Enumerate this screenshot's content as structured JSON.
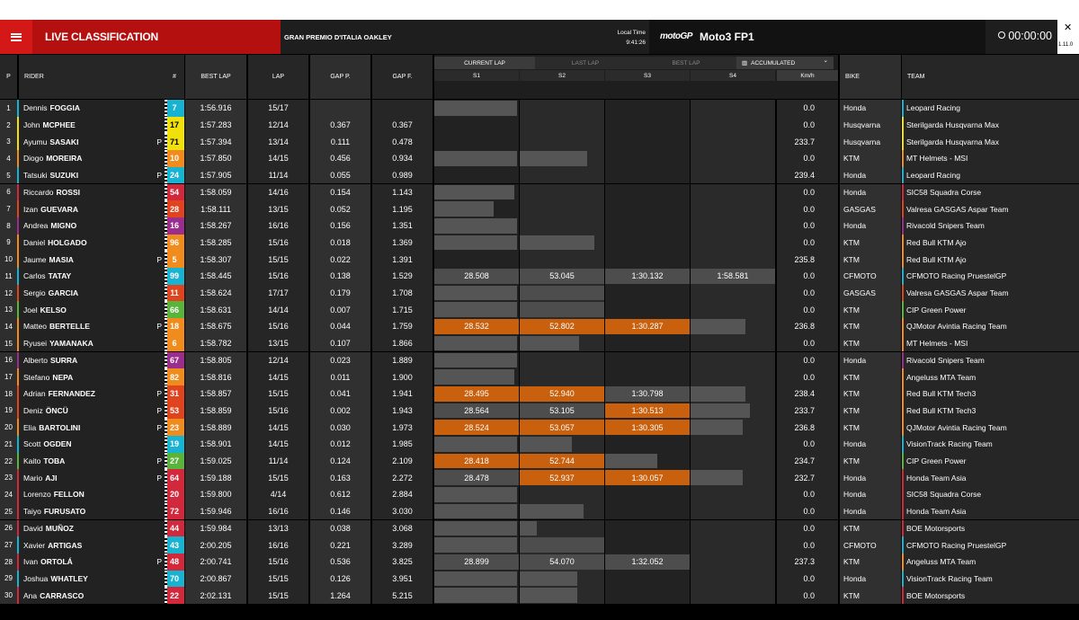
{
  "header": {
    "title": "LIVE CLASSIFICATION",
    "event": "GRAN PREMIO D'ITALIA OAKLEY",
    "local_time_label": "Local Time",
    "local_time": "9:41:26",
    "brand": "motoGP",
    "session": "Moto3 FP1",
    "timer": "00:00:00",
    "version": "1.11.0"
  },
  "columns": {
    "pos": "P",
    "rider": "RIDER",
    "num": "#",
    "best_lap": "BEST LAP",
    "lap": "LAP",
    "gap_p": "GAP P.",
    "gap_f": "GAP F.",
    "s1": "S1",
    "s2": "S2",
    "s3": "S3",
    "s4": "S4",
    "kmh": "Km/h",
    "bike": "BIKE",
    "team": "TEAM"
  },
  "lap_modes": [
    "CURRENT LAP",
    "LAST LAP",
    "BEST LAP"
  ],
  "selected_mode": "ACCUMULATED",
  "colors": {
    "orange": "#c8600e",
    "red": "#d41717"
  },
  "rows": [
    {
      "pos": "1",
      "first": "Dennis",
      "last": "FOGGIA",
      "p": "",
      "num": "7",
      "numcolor": "#19b3d2",
      "best": "1:56.916",
      "lap": "15/17",
      "gapp": "",
      "gapf": "",
      "b1": 0.98,
      "b2": 0,
      "b3": 0,
      "b4": 0,
      "s1": "",
      "s2": "",
      "s3": "",
      "s4": "",
      "o1": false,
      "o2": false,
      "o3": false,
      "kmh": "0.0",
      "bike": "Honda",
      "team": "Leopard Racing",
      "teamcolor": "#19b3d2"
    },
    {
      "pos": "2",
      "first": "John",
      "last": "MCPHEE",
      "p": "",
      "num": "17",
      "numcolor": "#f0e10a",
      "best": "1:57.283",
      "lap": "12/14",
      "gapp": "0.367",
      "gapf": "0.367",
      "b1": 0,
      "b2": 0,
      "b3": 0,
      "b4": 0,
      "s1": "",
      "s2": "",
      "s3": "",
      "s4": "",
      "o1": false,
      "o2": false,
      "o3": false,
      "kmh": "0.0",
      "bike": "Husqvarna",
      "team": "Sterilgarda Husqvarna Max",
      "teamcolor": "#f0e10a"
    },
    {
      "pos": "3",
      "first": "Ayumu",
      "last": "SASAKI",
      "p": "P",
      "num": "71",
      "numcolor": "#f0e10a",
      "best": "1:57.394",
      "lap": "13/14",
      "gapp": "0.111",
      "gapf": "0.478",
      "b1": 0,
      "b2": 0,
      "b3": 0,
      "b4": 0,
      "s1": "",
      "s2": "",
      "s3": "",
      "s4": "",
      "o1": false,
      "o2": false,
      "o3": false,
      "kmh": "233.7",
      "bike": "Husqvarna",
      "team": "Sterilgarda Husqvarna Max",
      "teamcolor": "#f0e10a"
    },
    {
      "pos": "4",
      "first": "Diogo",
      "last": "MOREIRA",
      "p": "",
      "num": "10",
      "numcolor": "#f08c1e",
      "best": "1:57.850",
      "lap": "14/15",
      "gapp": "0.456",
      "gapf": "0.934",
      "b1": 0.98,
      "b2": 0.8,
      "b3": 0,
      "b4": 0,
      "s1": "",
      "s2": "",
      "s3": "",
      "s4": "",
      "o1": false,
      "o2": false,
      "o3": false,
      "kmh": "0.0",
      "bike": "KTM",
      "team": "MT Helmets - MSI",
      "teamcolor": "#f08c1e"
    },
    {
      "pos": "5",
      "first": "Tatsuki",
      "last": "SUZUKI",
      "p": "P",
      "num": "24",
      "numcolor": "#19b3d2",
      "best": "1:57.905",
      "lap": "11/14",
      "gapp": "0.055",
      "gapf": "0.989",
      "b1": 0,
      "b2": 0,
      "b3": 0,
      "b4": 0,
      "s1": "",
      "s2": "",
      "s3": "",
      "s4": "",
      "o1": false,
      "o2": false,
      "o3": false,
      "kmh": "239.4",
      "bike": "Honda",
      "team": "Leopard Racing",
      "teamcolor": "#19b3d2"
    },
    {
      "pos": "6",
      "first": "Riccardo",
      "last": "ROSSI",
      "p": "",
      "num": "54",
      "numcolor": "#d2283c",
      "best": "1:58.059",
      "lap": "14/16",
      "gapp": "0.154",
      "gapf": "1.143",
      "b1": 0.95,
      "b2": 0,
      "b3": 0,
      "b4": 0,
      "s1": "",
      "s2": "",
      "s3": "",
      "s4": "",
      "o1": false,
      "o2": false,
      "o3": false,
      "kmh": "0.0",
      "bike": "Honda",
      "team": "SIC58 Squadra Corse",
      "teamcolor": "#d2283c"
    },
    {
      "pos": "7",
      "first": "Izan",
      "last": "GUEVARA",
      "p": "",
      "num": "28",
      "numcolor": "#e0441e",
      "best": "1:58.111",
      "lap": "13/15",
      "gapp": "0.052",
      "gapf": "1.195",
      "b1": 0.7,
      "b2": 0,
      "b3": 0,
      "b4": 0,
      "s1": "",
      "s2": "",
      "s3": "",
      "s4": "",
      "o1": false,
      "o2": false,
      "o3": false,
      "kmh": "0.0",
      "bike": "GASGAS",
      "team": "Valresa GASGAS Aspar Team",
      "teamcolor": "#e0441e"
    },
    {
      "pos": "8",
      "first": "Andrea",
      "last": "MIGNO",
      "p": "",
      "num": "16",
      "numcolor": "#9b2e8c",
      "best": "1:58.267",
      "lap": "16/16",
      "gapp": "0.156",
      "gapf": "1.351",
      "b1": 0.98,
      "b2": 0,
      "b3": 0,
      "b4": 0,
      "s1": "",
      "s2": "",
      "s3": "",
      "s4": "",
      "o1": false,
      "o2": false,
      "o3": false,
      "kmh": "0.0",
      "bike": "Honda",
      "team": "Rivacold Snipers Team",
      "teamcolor": "#9b2e8c"
    },
    {
      "pos": "9",
      "first": "Daniel",
      "last": "HOLGADO",
      "p": "",
      "num": "96",
      "numcolor": "#f08c1e",
      "best": "1:58.285",
      "lap": "15/16",
      "gapp": "0.018",
      "gapf": "1.369",
      "b1": 0.98,
      "b2": 0.88,
      "b3": 0,
      "b4": 0,
      "s1": "",
      "s2": "",
      "s3": "",
      "s4": "",
      "o1": false,
      "o2": false,
      "o3": false,
      "kmh": "0.0",
      "bike": "KTM",
      "team": "Red Bull KTM Ajo",
      "teamcolor": "#f08c1e"
    },
    {
      "pos": "10",
      "first": "Jaume",
      "last": "MASIA",
      "p": "P",
      "num": "5",
      "numcolor": "#f08c1e",
      "best": "1:58.307",
      "lap": "15/15",
      "gapp": "0.022",
      "gapf": "1.391",
      "b1": 0,
      "b2": 0,
      "b3": 0,
      "b4": 0,
      "s1": "",
      "s2": "",
      "s3": "",
      "s4": "",
      "o1": false,
      "o2": false,
      "o3": false,
      "kmh": "235.8",
      "bike": "KTM",
      "team": "Red Bull KTM Ajo",
      "teamcolor": "#f08c1e"
    },
    {
      "pos": "11",
      "first": "Carlos",
      "last": "TATAY",
      "p": "",
      "num": "99",
      "numcolor": "#19b3d2",
      "best": "1:58.445",
      "lap": "15/16",
      "gapp": "0.138",
      "gapf": "1.529",
      "b1": 1,
      "b2": 1,
      "b3": 1,
      "b4": 1,
      "s1": "28.508",
      "s2": "53.045",
      "s3": "1:30.132",
      "s4": "1:58.581",
      "o1": false,
      "o2": false,
      "o3": false,
      "kmh": "0.0",
      "bike": "CFMOTO",
      "team": "CFMOTO Racing PruestelGP",
      "teamcolor": "#19b3d2"
    },
    {
      "pos": "12",
      "first": "Sergio",
      "last": "GARCIA",
      "p": "",
      "num": "11",
      "numcolor": "#e0441e",
      "best": "1:58.624",
      "lap": "17/17",
      "gapp": "0.179",
      "gapf": "1.708",
      "b1": 0.98,
      "b2": 1,
      "b3": 0,
      "b4": 0,
      "s1": "",
      "s2": "",
      "s3": "",
      "s4": "",
      "o1": false,
      "o2": false,
      "o3": false,
      "kmh": "0.0",
      "bike": "GASGAS",
      "team": "Valresa GASGAS Aspar Team",
      "teamcolor": "#e0441e"
    },
    {
      "pos": "13",
      "first": "Joel",
      "last": "KELSO",
      "p": "",
      "num": "66",
      "numcolor": "#5ab43c",
      "best": "1:58.631",
      "lap": "14/14",
      "gapp": "0.007",
      "gapf": "1.715",
      "b1": 0.98,
      "b2": 1,
      "b3": 0,
      "b4": 0,
      "s1": "",
      "s2": "",
      "s3": "",
      "s4": "",
      "o1": false,
      "o2": false,
      "o3": false,
      "kmh": "0.0",
      "bike": "KTM",
      "team": "CIP Green Power",
      "teamcolor": "#5ab43c"
    },
    {
      "pos": "14",
      "first": "Matteo",
      "last": "BERTELLE",
      "p": "P",
      "num": "18",
      "numcolor": "#f08c1e",
      "best": "1:58.675",
      "lap": "15/16",
      "gapp": "0.044",
      "gapf": "1.759",
      "b1": 1,
      "b2": 1,
      "b3": 1,
      "b4": 0.65,
      "s1": "28.532",
      "s2": "52.802",
      "s3": "1:30.287",
      "s4": "",
      "o1": true,
      "o2": true,
      "o3": true,
      "kmh": "236.8",
      "bike": "KTM",
      "team": "QJMotor Avintia Racing Team",
      "teamcolor": "#f08c1e"
    },
    {
      "pos": "15",
      "first": "Ryusei",
      "last": "YAMANAKA",
      "p": "",
      "num": "6",
      "numcolor": "#f08c1e",
      "best": "1:58.782",
      "lap": "13/15",
      "gapp": "0.107",
      "gapf": "1.866",
      "b1": 0.98,
      "b2": 0.7,
      "b3": 0,
      "b4": 0,
      "s1": "",
      "s2": "",
      "s3": "",
      "s4": "",
      "o1": false,
      "o2": false,
      "o3": false,
      "kmh": "0.0",
      "bike": "KTM",
      "team": "MT Helmets - MSI",
      "teamcolor": "#f08c1e"
    },
    {
      "pos": "16",
      "first": "Alberto",
      "last": "SURRA",
      "p": "",
      "num": "67",
      "numcolor": "#9b2e8c",
      "best": "1:58.805",
      "lap": "12/14",
      "gapp": "0.023",
      "gapf": "1.889",
      "b1": 0.98,
      "b2": 0,
      "b3": 0,
      "b4": 0,
      "s1": "",
      "s2": "",
      "s3": "",
      "s4": "",
      "o1": false,
      "o2": false,
      "o3": false,
      "kmh": "0.0",
      "bike": "Honda",
      "team": "Rivacold Snipers Team",
      "teamcolor": "#9b2e8c"
    },
    {
      "pos": "17",
      "first": "Stefano",
      "last": "NEPA",
      "p": "",
      "num": "82",
      "numcolor": "#f08c1e",
      "best": "1:58.816",
      "lap": "14/15",
      "gapp": "0.011",
      "gapf": "1.900",
      "b1": 0.95,
      "b2": 0,
      "b3": 0,
      "b4": 0,
      "s1": "",
      "s2": "",
      "s3": "",
      "s4": "",
      "o1": false,
      "o2": false,
      "o3": false,
      "kmh": "0.0",
      "bike": "KTM",
      "team": "Angeluss MTA Team",
      "teamcolor": "#f08c1e"
    },
    {
      "pos": "18",
      "first": "Adrian",
      "last": "FERNANDEZ",
      "p": "P",
      "num": "31",
      "numcolor": "#e0441e",
      "best": "1:58.857",
      "lap": "15/15",
      "gapp": "0.041",
      "gapf": "1.941",
      "b1": 1,
      "b2": 1,
      "b3": 1,
      "b4": 0.65,
      "s1": "28.495",
      "s2": "52.940",
      "s3": "1:30.798",
      "s4": "",
      "o1": true,
      "o2": true,
      "o3": false,
      "kmh": "238.4",
      "bike": "KTM",
      "team": "Red Bull KTM Tech3",
      "teamcolor": "#f08c1e"
    },
    {
      "pos": "19",
      "first": "Deniz",
      "last": "ÖNCÜ",
      "p": "P",
      "num": "53",
      "numcolor": "#e0441e",
      "best": "1:58.859",
      "lap": "15/16",
      "gapp": "0.002",
      "gapf": "1.943",
      "b1": 1,
      "b2": 1,
      "b3": 1,
      "b4": 0.7,
      "s1": "28.564",
      "s2": "53.105",
      "s3": "1:30.513",
      "s4": "",
      "o1": false,
      "o2": false,
      "o3": true,
      "kmh": "233.7",
      "bike": "KTM",
      "team": "Red Bull KTM Tech3",
      "teamcolor": "#f08c1e"
    },
    {
      "pos": "20",
      "first": "Elia",
      "last": "BARTOLINI",
      "p": "P",
      "num": "23",
      "numcolor": "#f08c1e",
      "best": "1:58.889",
      "lap": "14/15",
      "gapp": "0.030",
      "gapf": "1.973",
      "b1": 1,
      "b2": 1,
      "b3": 1,
      "b4": 0.62,
      "s1": "28.524",
      "s2": "53.057",
      "s3": "1:30.305",
      "s4": "",
      "o1": true,
      "o2": true,
      "o3": true,
      "kmh": "236.8",
      "bike": "KTM",
      "team": "QJMotor Avintia Racing Team",
      "teamcolor": "#f08c1e"
    },
    {
      "pos": "21",
      "first": "Scott",
      "last": "OGDEN",
      "p": "",
      "num": "19",
      "numcolor": "#19b3d2",
      "best": "1:58.901",
      "lap": "14/15",
      "gapp": "0.012",
      "gapf": "1.985",
      "b1": 0.98,
      "b2": 0.62,
      "b3": 0,
      "b4": 0,
      "s1": "",
      "s2": "",
      "s3": "",
      "s4": "",
      "o1": false,
      "o2": false,
      "o3": false,
      "kmh": "0.0",
      "bike": "Honda",
      "team": "VisionTrack Racing Team",
      "teamcolor": "#19b3d2"
    },
    {
      "pos": "22",
      "first": "Kaito",
      "last": "TOBA",
      "p": "P",
      "num": "27",
      "numcolor": "#5ab43c",
      "best": "1:59.025",
      "lap": "11/14",
      "gapp": "0.124",
      "gapf": "2.109",
      "b1": 1,
      "b2": 1,
      "b3": 0.62,
      "b4": 0,
      "s1": "28.418",
      "s2": "52.744",
      "s3": "",
      "s4": "",
      "o1": true,
      "o2": true,
      "o3": false,
      "kmh": "234.7",
      "bike": "KTM",
      "team": "CIP Green Power",
      "teamcolor": "#5ab43c"
    },
    {
      "pos": "23",
      "first": "Mario",
      "last": "AJI",
      "p": "P",
      "num": "64",
      "numcolor": "#d2283c",
      "best": "1:59.188",
      "lap": "15/15",
      "gapp": "0.163",
      "gapf": "2.272",
      "b1": 1,
      "b2": 1,
      "b3": 1,
      "b4": 0.62,
      "s1": "28.478",
      "s2": "52.937",
      "s3": "1:30.057",
      "s4": "",
      "o1": false,
      "o2": true,
      "o3": true,
      "kmh": "232.7",
      "bike": "Honda",
      "team": "Honda Team Asia",
      "teamcolor": "#d2283c"
    },
    {
      "pos": "24",
      "first": "Lorenzo",
      "last": "FELLON",
      "p": "",
      "num": "20",
      "numcolor": "#d2283c",
      "best": "1:59.800",
      "lap": "4/14",
      "gapp": "0.612",
      "gapf": "2.884",
      "b1": 0.98,
      "b2": 0,
      "b3": 0,
      "b4": 0,
      "s1": "",
      "s2": "",
      "s3": "",
      "s4": "",
      "o1": false,
      "o2": false,
      "o3": false,
      "kmh": "0.0",
      "bike": "Honda",
      "team": "SIC58 Squadra Corse",
      "teamcolor": "#d2283c"
    },
    {
      "pos": "25",
      "first": "Taiyo",
      "last": "FURUSATO",
      "p": "",
      "num": "72",
      "numcolor": "#d2283c",
      "best": "1:59.946",
      "lap": "16/16",
      "gapp": "0.146",
      "gapf": "3.030",
      "b1": 0.98,
      "b2": 0.76,
      "b3": 0,
      "b4": 0,
      "s1": "",
      "s2": "",
      "s3": "",
      "s4": "",
      "o1": false,
      "o2": false,
      "o3": false,
      "kmh": "0.0",
      "bike": "Honda",
      "team": "Honda Team Asia",
      "teamcolor": "#d2283c"
    },
    {
      "pos": "26",
      "first": "David",
      "last": "MUÑOZ",
      "p": "",
      "num": "44",
      "numcolor": "#d2283c",
      "best": "1:59.984",
      "lap": "13/13",
      "gapp": "0.038",
      "gapf": "3.068",
      "b1": 0.98,
      "b2": 0.2,
      "b3": 0,
      "b4": 0,
      "s1": "",
      "s2": "",
      "s3": "",
      "s4": "",
      "o1": false,
      "o2": false,
      "o3": false,
      "kmh": "0.0",
      "bike": "KTM",
      "team": "BOE Motorsports",
      "teamcolor": "#d2283c"
    },
    {
      "pos": "27",
      "first": "Xavier",
      "last": "ARTIGAS",
      "p": "",
      "num": "43",
      "numcolor": "#19b3d2",
      "best": "2:00.205",
      "lap": "16/16",
      "gapp": "0.221",
      "gapf": "3.289",
      "b1": 0.98,
      "b2": 1,
      "b3": 0,
      "b4": 0,
      "s1": "",
      "s2": "",
      "s3": "",
      "s4": "",
      "o1": false,
      "o2": false,
      "o3": false,
      "kmh": "0.0",
      "bike": "CFMOTO",
      "team": "CFMOTO Racing PruestelGP",
      "teamcolor": "#19b3d2"
    },
    {
      "pos": "28",
      "first": "Ivan",
      "last": "ORTOLÁ",
      "p": "P",
      "num": "48",
      "numcolor": "#d2283c",
      "best": "2:00.741",
      "lap": "15/16",
      "gapp": "0.536",
      "gapf": "3.825",
      "b1": 1,
      "b2": 1,
      "b3": 1,
      "b4": 0,
      "s1": "28.899",
      "s2": "54.070",
      "s3": "1:32.052",
      "s4": "",
      "o1": false,
      "o2": false,
      "o3": false,
      "kmh": "237.3",
      "bike": "KTM",
      "team": "Angeluss MTA Team",
      "teamcolor": "#f08c1e"
    },
    {
      "pos": "29",
      "first": "Joshua",
      "last": "WHATLEY",
      "p": "",
      "num": "70",
      "numcolor": "#19b3d2",
      "best": "2:00.867",
      "lap": "15/15",
      "gapp": "0.126",
      "gapf": "3.951",
      "b1": 0.98,
      "b2": 0.68,
      "b3": 0,
      "b4": 0,
      "s1": "",
      "s2": "",
      "s3": "",
      "s4": "",
      "o1": false,
      "o2": false,
      "o3": false,
      "kmh": "0.0",
      "bike": "Honda",
      "team": "VisionTrack Racing Team",
      "teamcolor": "#19b3d2"
    },
    {
      "pos": "30",
      "first": "Ana",
      "last": "CARRASCO",
      "p": "",
      "num": "22",
      "numcolor": "#d2283c",
      "best": "2:02.131",
      "lap": "15/15",
      "gapp": "1.264",
      "gapf": "5.215",
      "b1": 0.98,
      "b2": 0.68,
      "b3": 0,
      "b4": 0,
      "s1": "",
      "s2": "",
      "s3": "",
      "s4": "",
      "o1": false,
      "o2": false,
      "o3": false,
      "kmh": "0.0",
      "bike": "KTM",
      "team": "BOE Motorsports",
      "teamcolor": "#d2283c"
    }
  ]
}
